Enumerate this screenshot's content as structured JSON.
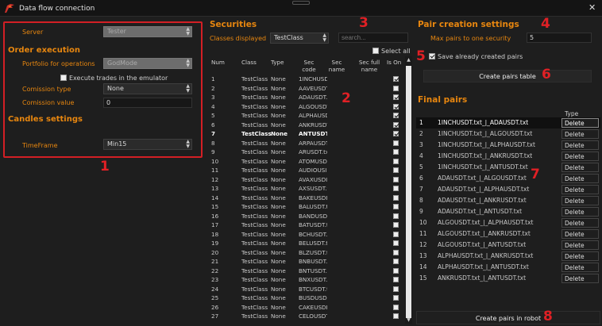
{
  "window": {
    "title": "Data flow connection",
    "close_glyph": "✕"
  },
  "markers": [
    "1",
    "2",
    "3",
    "4",
    "5",
    "6",
    "7",
    "8"
  ],
  "connection": {
    "server_label": "Server",
    "server_value": "Tester",
    "order_heading": "Order execution",
    "portfolio_label": "Portfolio for operations",
    "portfolio_value": "GodMode",
    "emulator_label": "Execute trades in the emulator",
    "commission_type_label": "Comission type",
    "commission_type_value": "None",
    "commission_value_label": "Comission value",
    "commission_value": "0",
    "candles_heading": "Candles settings",
    "timeframe_label": "TimeFrame",
    "timeframe_value": "Min15"
  },
  "securities": {
    "heading": "Securities",
    "classes_label": "Classes displayed",
    "classes_value": "TestClass",
    "search_placeholder": "search...",
    "select_all_label": "Select all",
    "columns": [
      "Num",
      "Class",
      "Type",
      "Sec code",
      "Sec name",
      "Sec full name",
      "Is On"
    ],
    "rows": [
      [
        "1",
        "TestClass",
        "None",
        "1INCHUSD",
        true
      ],
      [
        "2",
        "TestClass",
        "None",
        "AAVEUSDT",
        false
      ],
      [
        "3",
        "TestClass",
        "None",
        "ADAUSDT.",
        true
      ],
      [
        "4",
        "TestClass",
        "None",
        "ALGOUSDT",
        true
      ],
      [
        "5",
        "TestClass",
        "None",
        "ALPHAUSD",
        true
      ],
      [
        "6",
        "TestClass",
        "None",
        "ANKRUSDT",
        true
      ],
      [
        "7",
        "TestClass",
        "None",
        "ANTUSDT.",
        true
      ],
      [
        "8",
        "TestClass",
        "None",
        "ARPAUSDT",
        false
      ],
      [
        "9",
        "TestClass",
        "None",
        "ARUSDT.tx",
        false
      ],
      [
        "10",
        "TestClass",
        "None",
        "ATOMUSD",
        false
      ],
      [
        "11",
        "TestClass",
        "None",
        "AUDIOUSI",
        false
      ],
      [
        "12",
        "TestClass",
        "None",
        "AVAXUSDI",
        false
      ],
      [
        "13",
        "TestClass",
        "None",
        "AXSUSDT.t",
        false
      ],
      [
        "14",
        "TestClass",
        "None",
        "BAKEUSDI",
        false
      ],
      [
        "15",
        "TestClass",
        "None",
        "BALUSDT.t",
        false
      ],
      [
        "16",
        "TestClass",
        "None",
        "BANDUSD",
        false
      ],
      [
        "17",
        "TestClass",
        "None",
        "BATUSDT.t",
        false
      ],
      [
        "18",
        "TestClass",
        "None",
        "BCHUSDT.",
        false
      ],
      [
        "19",
        "TestClass",
        "None",
        "BELUSDT.t",
        false
      ],
      [
        "20",
        "TestClass",
        "None",
        "BLZUSDT.t",
        false
      ],
      [
        "21",
        "TestClass",
        "None",
        "BNBUSDT.",
        false
      ],
      [
        "22",
        "TestClass",
        "None",
        "BNTUSDT.",
        false
      ],
      [
        "23",
        "TestClass",
        "None",
        "BNXUSDT.",
        false
      ],
      [
        "24",
        "TestClass",
        "None",
        "BTCUSDT.t",
        false
      ],
      [
        "25",
        "TestClass",
        "None",
        "BUSDUSD",
        false
      ],
      [
        "26",
        "TestClass",
        "None",
        "CAKEUSDI",
        false
      ],
      [
        "27",
        "TestClass",
        "None",
        "CELOUSDT",
        false
      ]
    ],
    "selected_row": 6
  },
  "pair_settings": {
    "heading": "Pair creation settings",
    "max_pairs_label": "Max pairs to one security",
    "max_pairs_value": "5",
    "save_pairs_label": "Save already created pairs",
    "save_pairs_checked": true,
    "create_table_button": "Create pairs table"
  },
  "final_pairs": {
    "heading": "Final pairs",
    "type_header": "Type",
    "delete_label": "Delete",
    "rows": [
      [
        "1",
        "1INCHUSDT.txt_|_ADAUSDT.txt"
      ],
      [
        "2",
        "1INCHUSDT.txt_|_ALGOUSDT.txt"
      ],
      [
        "3",
        "1INCHUSDT.txt_|_ALPHAUSDT.txt"
      ],
      [
        "4",
        "1INCHUSDT.txt_|_ANKRUSDT.txt"
      ],
      [
        "5",
        "1INCHUSDT.txt_|_ANTUSDT.txt"
      ],
      [
        "6",
        "ADAUSDT.txt_|_ALGOUSDT.txt"
      ],
      [
        "7",
        "ADAUSDT.txt_|_ALPHAUSDT.txt"
      ],
      [
        "8",
        "ADAUSDT.txt_|_ANKRUSDT.txt"
      ],
      [
        "9",
        "ADAUSDT.txt_|_ANTUSDT.txt"
      ],
      [
        "10",
        "ALGOUSDT.txt_|_ALPHAUSDT.txt"
      ],
      [
        "11",
        "ALGOUSDT.txt_|_ANKRUSDT.txt"
      ],
      [
        "12",
        "ALGOUSDT.txt_|_ANTUSDT.txt"
      ],
      [
        "13",
        "ALPHAUSDT.txt_|_ANKRUSDT.txt"
      ],
      [
        "14",
        "ALPHAUSDT.txt_|_ANTUSDT.txt"
      ],
      [
        "15",
        "ANKRUSDT.txt_|_ANTUSDT.txt"
      ]
    ],
    "create_robot_button": "Create pairs in robot"
  }
}
